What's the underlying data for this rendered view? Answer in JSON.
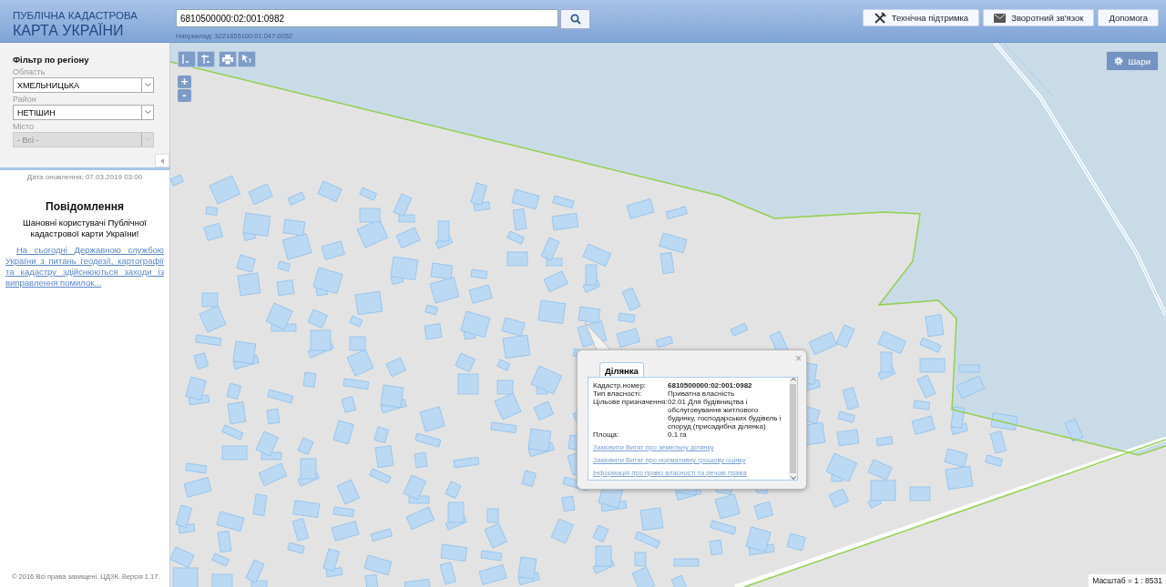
{
  "header": {
    "title_top": "ПУБЛІЧНА КАДАСТРОВА",
    "title_main": "КАРТА УКРАЇНИ",
    "search": {
      "value": "6810500000:02:001:0982",
      "hint": "Наприклад: 3221655100:01:047:0052"
    },
    "buttons": [
      {
        "kind": "tools",
        "label": "Технічна підтримка"
      },
      {
        "kind": "mail",
        "label": "Зворотний зв'язок"
      },
      {
        "kind": "plain",
        "label": "Допомога"
      }
    ]
  },
  "sidebar": {
    "title": "Фільтр по регіону",
    "filters": [
      {
        "label": "Область",
        "value": "ХМЕЛЬНИЦЬКА",
        "disabled": false
      },
      {
        "label": "Район",
        "value": "НЕТІШИН",
        "disabled": false
      },
      {
        "label": "Місто",
        "value": "- Всі -",
        "disabled": true
      }
    ],
    "update_date": "Дата оновлення: 07.03.2019 03:00",
    "notice": {
      "title": "Повідомлення",
      "text": "Шановні користувачі Публічної кадастрової карти України!",
      "link": "На сьогодні Державною службою України з питань геодезії, картографії та кадастру здійснюються заходи із виправлення помилок..."
    },
    "copyright": "© 2016 Всі права захищені. ЦДЗК. Версія 1.17."
  },
  "map": {
    "zoom_in": "+",
    "zoom_out": "-",
    "layers_button": "Шари",
    "scale": "Масштаб = 1 : 8531",
    "popup": {
      "close": "×",
      "tab": "Ділянка",
      "fields": [
        {
          "label": "Кадастр.номер:",
          "value": "6810500000:02:001:0982",
          "kind": "bold"
        },
        {
          "label": "Тип власності:",
          "value": "Приватна власність",
          "kind": "plain"
        },
        {
          "label": "Цільове призначення:",
          "value": "02.01 Для будівництва і обслуговування житлового будинку, господарських будівель і споруд (присадибна ділянка)",
          "kind": "plain"
        },
        {
          "label": "Площа:",
          "value": "0.1 га",
          "kind": "plain"
        }
      ],
      "links": [
        "Замовити Витяг про земельну ділянку",
        "Замовити Витяг про нормативну грошову оцінку",
        "Інформація про право власності та речові права"
      ]
    }
  }
}
